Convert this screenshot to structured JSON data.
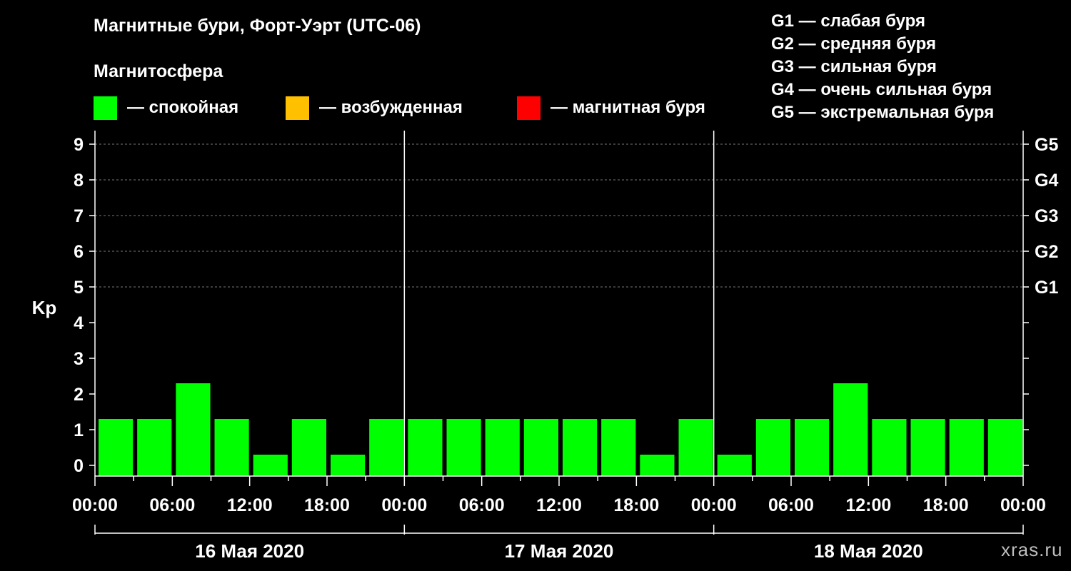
{
  "header": {
    "title": "Магнитные бури, Форт-Уэрт (UTC-06)",
    "subtitle": "Магнитосфера"
  },
  "legend": [
    {
      "label": "— спокойная",
      "color": "#00ff00"
    },
    {
      "label": "— возбужденная",
      "color": "#ffc000"
    },
    {
      "label": "— магнитная буря",
      "color": "#ff0000"
    }
  ],
  "storm_scale": [
    "G1 — слабая буря",
    "G2 — средняя буря",
    "G3 — сильная буря",
    "G4 — очень сильная буря",
    "G5 — экстремальная буря"
  ],
  "watermark": "xras.ru",
  "chart_data": {
    "type": "bar",
    "ylabel": "Kp",
    "ylim": [
      0,
      9
    ],
    "yticks": [
      0,
      1,
      2,
      3,
      4,
      5,
      6,
      7,
      8,
      9
    ],
    "right_ticks": [
      {
        "y": 5,
        "label": "G1"
      },
      {
        "y": 6,
        "label": "G2"
      },
      {
        "y": 7,
        "label": "G3"
      },
      {
        "y": 8,
        "label": "G4"
      },
      {
        "y": 9,
        "label": "G5"
      }
    ],
    "grid": "dashed horizontal at 5, 6, 7, 8, 9",
    "x_tick_labels": [
      "00:00",
      "06:00",
      "12:00",
      "18:00",
      "00:00",
      "06:00",
      "12:00",
      "18:00",
      "00:00",
      "06:00",
      "12:00",
      "18:00",
      "00:00"
    ],
    "days": [
      "16 Мая 2020",
      "17 Мая 2020",
      "18 Мая 2020"
    ],
    "interval_hours": 3,
    "bar_color": "#00ff00",
    "series": [
      {
        "values": [
          1,
          1,
          2,
          1,
          0,
          1,
          0,
          1,
          1,
          1,
          1,
          1,
          1,
          1,
          0,
          1,
          0,
          1,
          1,
          2,
          1,
          1,
          1,
          1
        ]
      }
    ]
  }
}
